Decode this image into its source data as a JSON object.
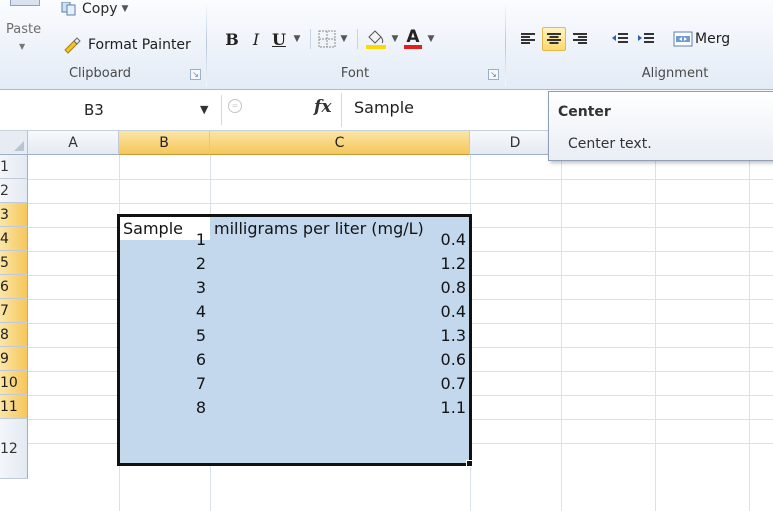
{
  "ribbon": {
    "clipboard": {
      "paste_label": "Paste",
      "copy_label": "Copy",
      "format_painter_label": "Format Painter",
      "group_label": "Clipboard"
    },
    "font": {
      "bold": "B",
      "italic": "I",
      "underline": "U",
      "font_color_glyph": "A",
      "group_label": "Font"
    },
    "alignment": {
      "merge_label": "Merg",
      "group_label": "Alignment"
    },
    "colors": {
      "fill_highlight": "#ffd800",
      "font_color": "#e02020"
    }
  },
  "formula_bar": {
    "name_box": "B3",
    "function_icon": "fx",
    "content": "Sample"
  },
  "tooltip": {
    "title": "Center",
    "description": "Center text."
  },
  "columns": [
    "A",
    "B",
    "C",
    "D"
  ],
  "rows": [
    "1",
    "2",
    "3",
    "4",
    "5",
    "6",
    "7",
    "8",
    "9",
    "10",
    "11",
    "12"
  ],
  "table": {
    "header_sample": "Sample",
    "header_value": "milligrams per liter (mg/L)",
    "rows": [
      {
        "sample": "1",
        "value": "0.4"
      },
      {
        "sample": "2",
        "value": "1.2"
      },
      {
        "sample": "3",
        "value": "0.8"
      },
      {
        "sample": "4",
        "value": "0.4"
      },
      {
        "sample": "5",
        "value": "1.3"
      },
      {
        "sample": "6",
        "value": "0.6"
      },
      {
        "sample": "7",
        "value": "0.7"
      },
      {
        "sample": "8",
        "value": "1.1"
      }
    ]
  },
  "selection_color": "#c3d7ed"
}
